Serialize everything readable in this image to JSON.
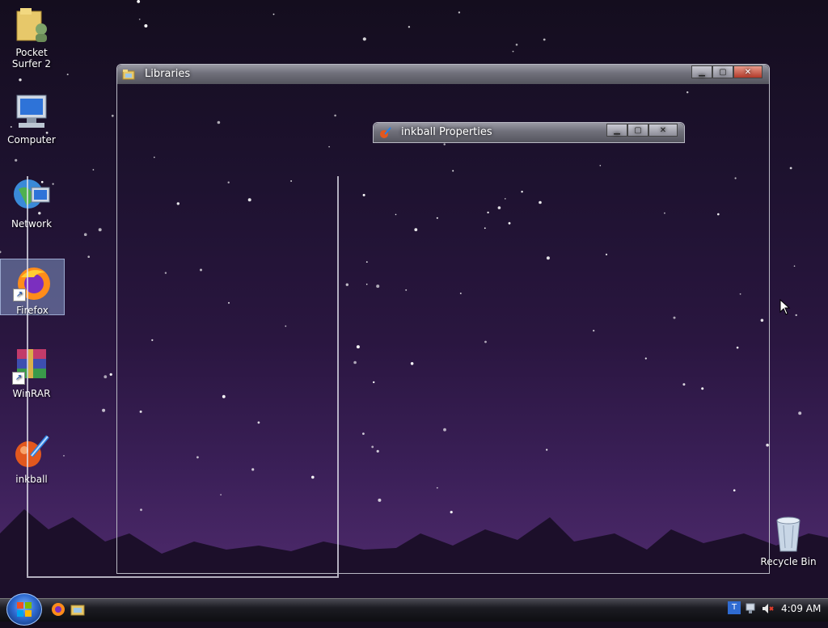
{
  "desktop": {
    "icons": [
      {
        "label": "Pocket Surfer 2",
        "icon": "folder-user-icon"
      },
      {
        "label": "Computer",
        "icon": "computer-icon"
      },
      {
        "label": "Network",
        "icon": "network-icon"
      },
      {
        "label": "Firefox",
        "icon": "firefox-icon"
      },
      {
        "label": "WinRAR",
        "icon": "winrar-icon"
      },
      {
        "label": "inkball",
        "icon": "inkball-icon"
      }
    ],
    "recycle_bin": "Recycle Bin"
  },
  "windows": {
    "libraries": {
      "title": "Libraries",
      "icon": "libraries-folder-icon"
    },
    "inkball_properties": {
      "title": "inkball Properties",
      "icon": "inkball-icon"
    }
  },
  "taskbar": {
    "pinned": [
      "firefox-icon",
      "explorer-icon"
    ],
    "clock": "4:09 AM",
    "tray_icons": [
      "ime-icon",
      "network-tray-icon",
      "volume-muted-icon"
    ]
  },
  "colors": {
    "accent": "#2f6bd1",
    "sky_top": "#140d1e",
    "sky_bottom": "#4a2868"
  }
}
